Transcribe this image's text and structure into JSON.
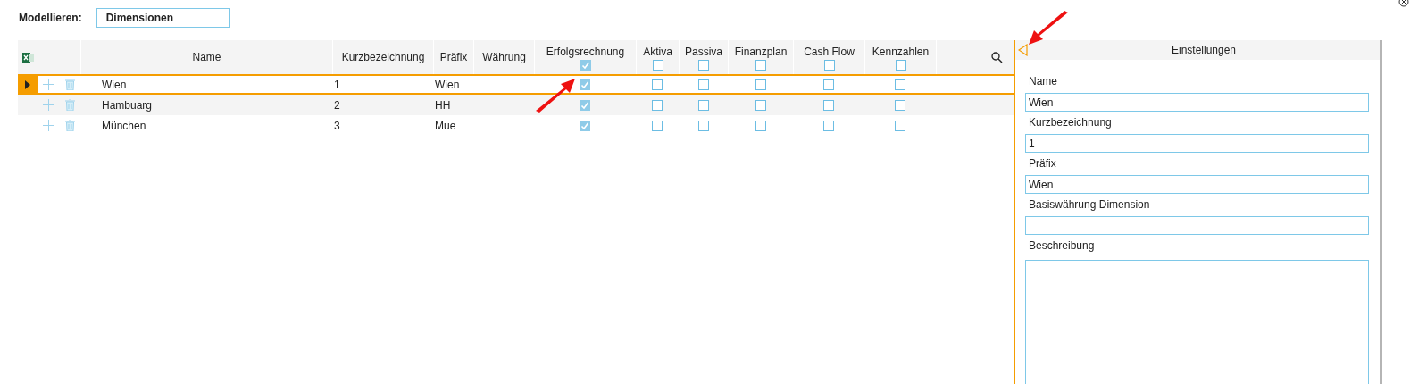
{
  "toolbar": {
    "label": "Modellieren:",
    "value": "Dimensionen"
  },
  "table": {
    "columns": [
      {
        "label": "Name",
        "kind": "text"
      },
      {
        "label": "Kurzbezeichnung",
        "kind": "text"
      },
      {
        "label": "Präfix",
        "kind": "text"
      },
      {
        "label": "Währung",
        "kind": "text"
      },
      {
        "label": "Erfolgsrechnung",
        "kind": "check",
        "checked": true
      },
      {
        "label": "Aktiva",
        "kind": "check",
        "checked": false
      },
      {
        "label": "Passiva",
        "kind": "check",
        "checked": false
      },
      {
        "label": "Finanzplan",
        "kind": "check",
        "checked": false
      },
      {
        "label": "Cash Flow",
        "kind": "check",
        "checked": false
      },
      {
        "label": "Kennzahlen",
        "kind": "check",
        "checked": false
      }
    ],
    "rows": [
      {
        "selected": true,
        "cells": [
          "Wien",
          "1",
          "Wien"
        ],
        "checks": [
          true,
          false,
          false,
          false,
          false,
          false
        ]
      },
      {
        "selected": false,
        "cells": [
          "Hambuarg",
          "2",
          "HH"
        ],
        "checks": [
          true,
          false,
          false,
          false,
          false,
          false
        ]
      },
      {
        "selected": false,
        "cells": [
          "München",
          "3",
          "Mue"
        ],
        "checks": [
          true,
          false,
          false,
          false,
          false,
          false
        ]
      }
    ]
  },
  "settings": {
    "title": "Einstellungen",
    "fields": [
      {
        "label": "Name",
        "value": "Wien",
        "kind": "line"
      },
      {
        "label": "Kurzbezeichnung",
        "value": "1",
        "kind": "line"
      },
      {
        "label": "Präfix",
        "value": "Wien",
        "kind": "line"
      },
      {
        "label": "Basiswährung Dimension",
        "kind": "line"
      },
      {
        "label": "Beschreibung",
        "kind": "area"
      }
    ]
  }
}
